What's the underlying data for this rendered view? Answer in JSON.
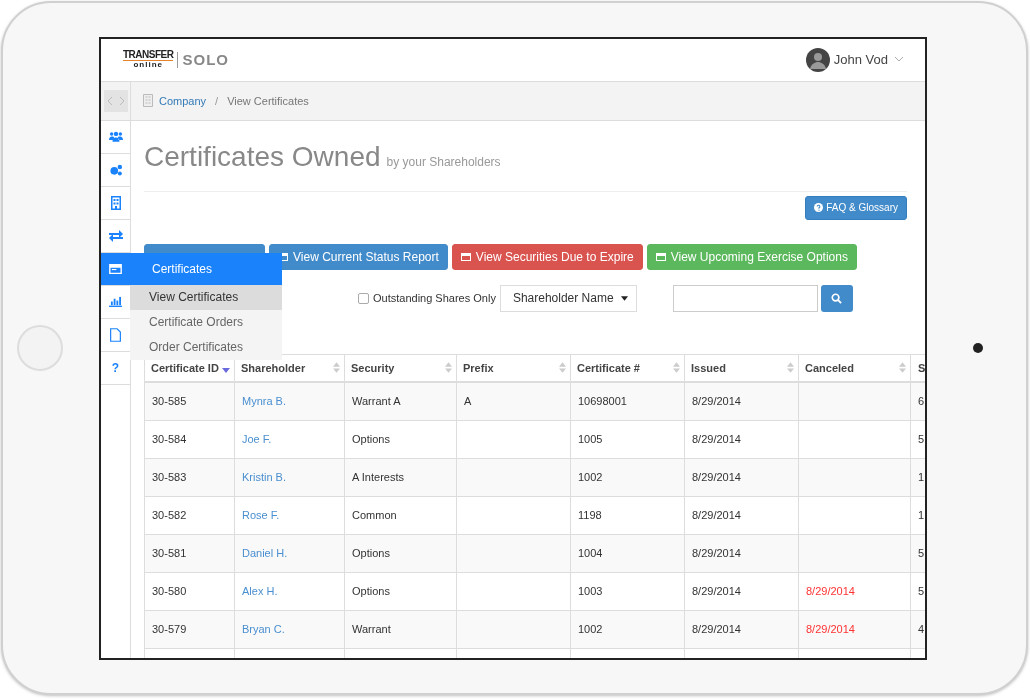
{
  "header": {
    "logo": {
      "word": "TRANSFER",
      "sub": "online",
      "product": "SOLO"
    },
    "user": {
      "name": "John Vod"
    }
  },
  "sidebar": {
    "items": [
      {
        "kind": "users",
        "selected": false
      },
      {
        "kind": "cogs",
        "selected": false
      },
      {
        "kind": "building",
        "selected": false
      },
      {
        "kind": "exchange",
        "selected": false
      },
      {
        "kind": "card",
        "selected": true
      },
      {
        "kind": "chart",
        "selected": false
      },
      {
        "kind": "file",
        "selected": false
      },
      {
        "kind": "help",
        "glyph": "?",
        "selected": false
      }
    ]
  },
  "flyout": {
    "title": "Certificates",
    "items": [
      {
        "label": "View Certificates",
        "selected": true
      },
      {
        "label": "Certificate Orders",
        "selected": false
      },
      {
        "label": "Order Certificates",
        "selected": false
      }
    ]
  },
  "breadcrumb": {
    "separator": "/",
    "items": [
      {
        "label": "Company",
        "kind": "link"
      },
      {
        "label": "View Certificates",
        "kind": "current"
      }
    ]
  },
  "page": {
    "title": "Certificates Owned",
    "subtitle": "by your Shareholders",
    "help_button": "FAQ & Glossary"
  },
  "action_buttons": [
    {
      "color": "#428bca"
    },
    {
      "label": "View Current Status Report",
      "color": "#428bca"
    },
    {
      "label": "View Securities Due to Expire",
      "color": "#d9534f"
    },
    {
      "label": "View Upcoming Exercise Options",
      "color": "#5cb85c"
    }
  ],
  "filters": {
    "outstanding": {
      "label": "Outstanding Shares Only",
      "checked": false
    },
    "search_by": {
      "value": "Shareholder Name"
    }
  },
  "table": {
    "columns": [
      {
        "label": "Certificate ID",
        "sorted": true
      },
      {
        "label": "Shareholder",
        "sorted": false
      },
      {
        "label": "Security",
        "sorted": false
      },
      {
        "label": "Prefix",
        "sorted": false
      },
      {
        "label": "Certificate #",
        "sorted": false
      },
      {
        "label": "Issued",
        "sorted": false
      },
      {
        "label": "Canceled",
        "sorted": false
      },
      {
        "label": "S"
      }
    ],
    "rows": [
      [
        "30-585",
        "Mynra B.",
        "Warrant A",
        "A",
        "10698001",
        "8/29/2014",
        "",
        "6"
      ],
      [
        "30-584",
        "Joe F.",
        "Options",
        "",
        "1005",
        "8/29/2014",
        "",
        "5"
      ],
      [
        "30-583",
        "Kristin B.",
        "A Interests",
        "",
        "1002",
        "8/29/2014",
        "",
        "1"
      ],
      [
        "30-582",
        "Rose F.",
        "Common",
        "",
        "1198",
        "8/29/2014",
        "",
        "1"
      ],
      [
        "30-581",
        "Daniel H.",
        "Options",
        "",
        "1004",
        "8/29/2014",
        "",
        "5"
      ],
      [
        "30-580",
        "Alex H.",
        "Options",
        "",
        "1003",
        "8/29/2014",
        "8/29/2014",
        "5"
      ],
      [
        "30-579",
        "Bryan C.",
        "Warrant",
        "",
        "1002",
        "8/29/2014",
        "8/29/2014",
        "4"
      ],
      [
        "",
        "",
        "",
        "",
        "",
        "",
        "",
        ""
      ]
    ]
  }
}
